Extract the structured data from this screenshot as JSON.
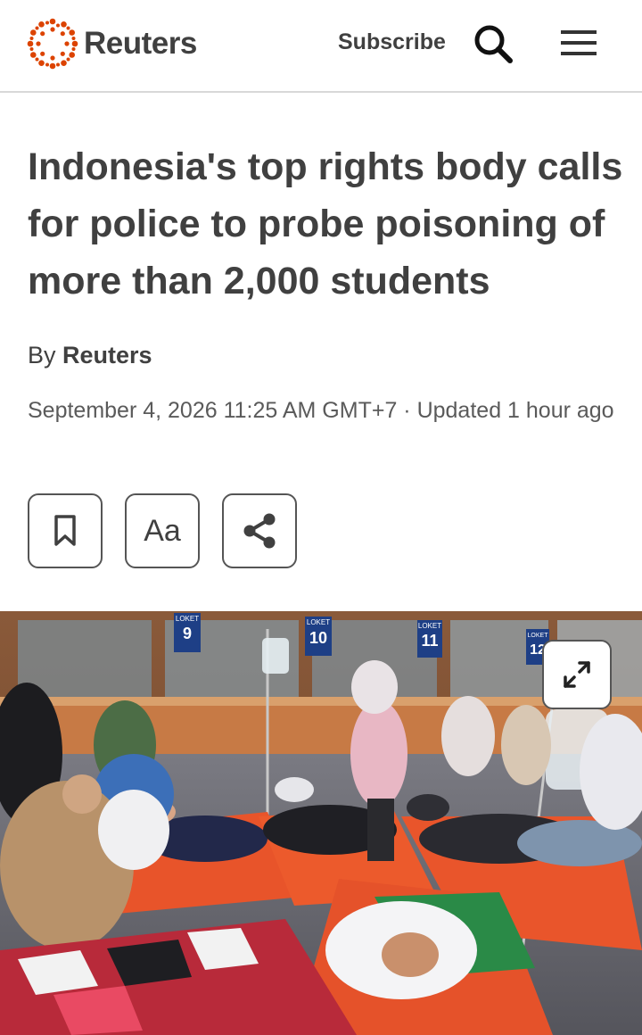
{
  "header": {
    "logo_text": "Reuters",
    "subscribe_label": "Subscribe",
    "brand_color": "#dc4300"
  },
  "article": {
    "headline": "Indonesia's top rights body calls for police to probe poisoning of more than 2,000 students",
    "byline_prefix": "By",
    "byline_author": "Reuters",
    "dateline": "September 4, 2026 11:25 AM GMT+7 · Updated 1 hour ago",
    "aa_label": "Aa"
  },
  "photo": {
    "signs": [
      "LOKET",
      "9",
      "LOKET",
      "10",
      "LOKET",
      "11",
      "LOKET",
      "12"
    ]
  }
}
